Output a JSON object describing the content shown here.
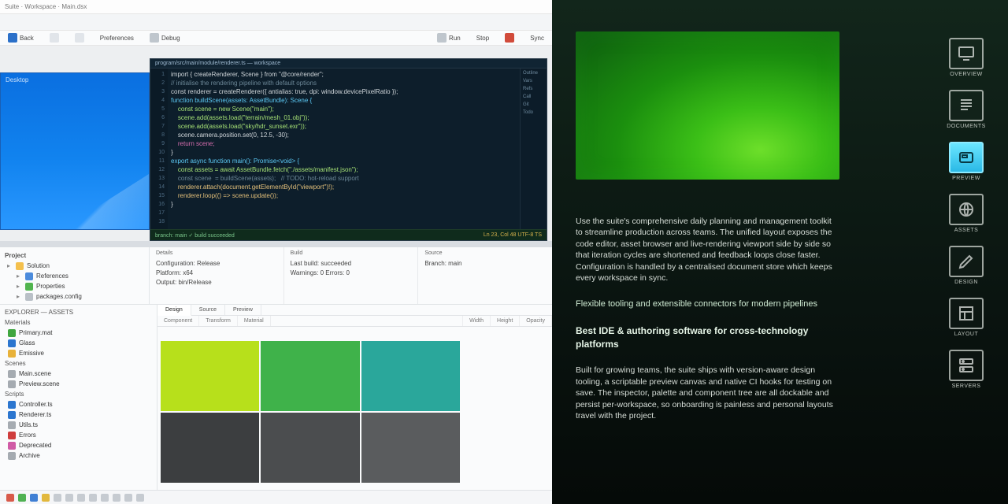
{
  "title_strip": "Suite · Workspace · Main.dsx",
  "toolbar": {
    "items_left": [
      {
        "label": "Back"
      },
      {
        "label": ""
      },
      {
        "label": ""
      },
      {
        "label": "Preferences"
      },
      {
        "label": "Debug"
      }
    ],
    "items_right": [
      {
        "label": "Run"
      },
      {
        "label": "Stop"
      },
      {
        "label": ""
      },
      {
        "label": "Sync"
      }
    ]
  },
  "desktop_thumb": {
    "caption": "Desktop"
  },
  "editor": {
    "title": "program/src/main/module/renderer.ts — workspace",
    "side_items": [
      "Outline",
      "Vars",
      "Refs",
      "Call",
      "Git",
      "Todo"
    ],
    "status_left": "branch: main  ✓ build succeeded",
    "status_right": "Ln 23, Col 48  UTF-8  TS",
    "gutter": [
      "1",
      "2",
      "3",
      "4",
      "5",
      "6",
      "7",
      "8",
      "9",
      "10",
      "11",
      "12",
      "13",
      "14",
      "15",
      "16",
      "17",
      "18"
    ],
    "lines": [
      {
        "t": "import { createRenderer, Scene } from \"@core/render\";",
        "cls": "n"
      },
      {
        "t": "// initialise the rendering pipeline with default options",
        "cls": "c"
      },
      {
        "t": "const renderer = createRenderer({ antialias: true, dpi: window.devicePixelRatio });",
        "cls": "n"
      },
      {
        "t": "",
        "cls": "n"
      },
      {
        "t": "function buildScene(assets: AssetBundle): Scene {",
        "cls": "k"
      },
      {
        "t": "    const scene = new Scene(\"main\");",
        "cls": "s"
      },
      {
        "t": "    scene.add(assets.load(\"terrain/mesh_01.obj\"));",
        "cls": "s"
      },
      {
        "t": "    scene.add(assets.load(\"sky/hdr_sunset.exr\"));",
        "cls": "s"
      },
      {
        "t": "    scene.camera.position.set(0, 12.5, -30);",
        "cls": "n"
      },
      {
        "t": "    return scene;",
        "cls": "p"
      },
      {
        "t": "}",
        "cls": "n"
      },
      {
        "t": "",
        "cls": "n"
      },
      {
        "t": "export async function main(): Promise<void> {",
        "cls": "k"
      },
      {
        "t": "    const assets = await AssetBundle.fetch(\"./assets/manifest.json\");",
        "cls": "s"
      },
      {
        "t": "    const scene  = buildScene(assets);   // TODO: hot-reload support",
        "cls": "c"
      },
      {
        "t": "    renderer.attach(document.getElementById(\"viewport\")!);",
        "cls": "f"
      },
      {
        "t": "    renderer.loop(() => scene.update());",
        "cls": "f"
      },
      {
        "t": "}",
        "cls": "n"
      }
    ]
  },
  "tree": {
    "header": "Project",
    "rows": [
      {
        "icon": "ic-folder",
        "label": "Solution"
      },
      {
        "icon": "ic-blue",
        "label": "References",
        "indent": 1
      },
      {
        "icon": "ic-green",
        "label": "Properties",
        "indent": 1
      },
      {
        "icon": "ic-grey",
        "label": "packages.config",
        "indent": 1
      }
    ]
  },
  "info_cols": [
    {
      "hdr": "Details",
      "rows": [
        "Configuration: Release",
        "Platform: x64",
        "Output: bin/Release"
      ]
    },
    {
      "hdr": "Build",
      "rows": [
        "Last build: succeeded",
        "Warnings: 0  Errors: 0"
      ]
    },
    {
      "hdr": "Source",
      "rows": [
        "Branch: main"
      ]
    }
  ],
  "explorer": {
    "title": "EXPLORER — ASSETS",
    "groups": [
      {
        "hdr": "Materials",
        "items": [
          {
            "sw": "sw-green",
            "label": "Primary.mat"
          },
          {
            "sw": "sw-blue",
            "label": "Glass"
          },
          {
            "sw": "sw-yel",
            "label": "Emissive"
          }
        ]
      },
      {
        "hdr": "Scenes",
        "items": [
          {
            "sw": "sw-gy",
            "label": "Main.scene"
          },
          {
            "sw": "sw-gy",
            "label": "Preview.scene"
          }
        ]
      },
      {
        "hdr": "Scripts",
        "items": [
          {
            "sw": "sw-blue",
            "label": "Controller.ts"
          },
          {
            "sw": "sw-blue",
            "label": "Renderer.ts"
          },
          {
            "sw": "sw-gy",
            "label": "Utils.ts"
          }
        ]
      },
      {
        "hdr": "",
        "items": [
          {
            "sw": "sw-red",
            "label": "Errors"
          },
          {
            "sw": "sw-pk",
            "label": "Deprecated"
          },
          {
            "sw": "sw-gy",
            "label": "Archive"
          }
        ]
      }
    ]
  },
  "designer": {
    "tabs": [
      {
        "label": "Design",
        "active": true
      },
      {
        "label": "Source"
      },
      {
        "label": "Preview"
      }
    ],
    "inspector": [
      "Component",
      "Transform",
      "Material",
      "",
      "Width",
      "Height",
      "Opacity"
    ],
    "palette_colors": [
      "#b7e01b",
      "#3fb24a",
      "#2aa79b",
      "#3c3e40",
      "#4b4d4f",
      "#5a5c5e"
    ]
  },
  "bottom_icons": 12,
  "right": {
    "para1": "Use the suite's comprehensive daily planning and management toolkit to streamline production across teams. The unified layout exposes the code editor, asset browser and live-rendering viewport side by side so that iteration cycles are shortened and feedback loops close faster. Configuration is handled by a centralised document store which keeps every workspace in sync.",
    "subheading": "Flexible tooling and extensible connectors for modern pipelines",
    "heading": "Best IDE & authoring software for cross-technology platforms",
    "para2": "Built for growing teams, the suite ships with version-aware design tooling, a scriptable preview canvas and native CI hooks for testing on save. The inspector, palette and component tree are all dockable and persist per-workspace, so onboarding is painless and personal layouts travel with the project.",
    "nav": [
      {
        "label": "Overview",
        "icon": "monitor"
      },
      {
        "label": "Documents",
        "icon": "doc"
      },
      {
        "label": "Preview",
        "icon": "window",
        "active": true
      },
      {
        "label": "Assets",
        "icon": "globe"
      },
      {
        "label": "Design",
        "icon": "pen"
      },
      {
        "label": "Layout",
        "icon": "layout"
      },
      {
        "label": "Servers",
        "icon": "server"
      }
    ]
  }
}
